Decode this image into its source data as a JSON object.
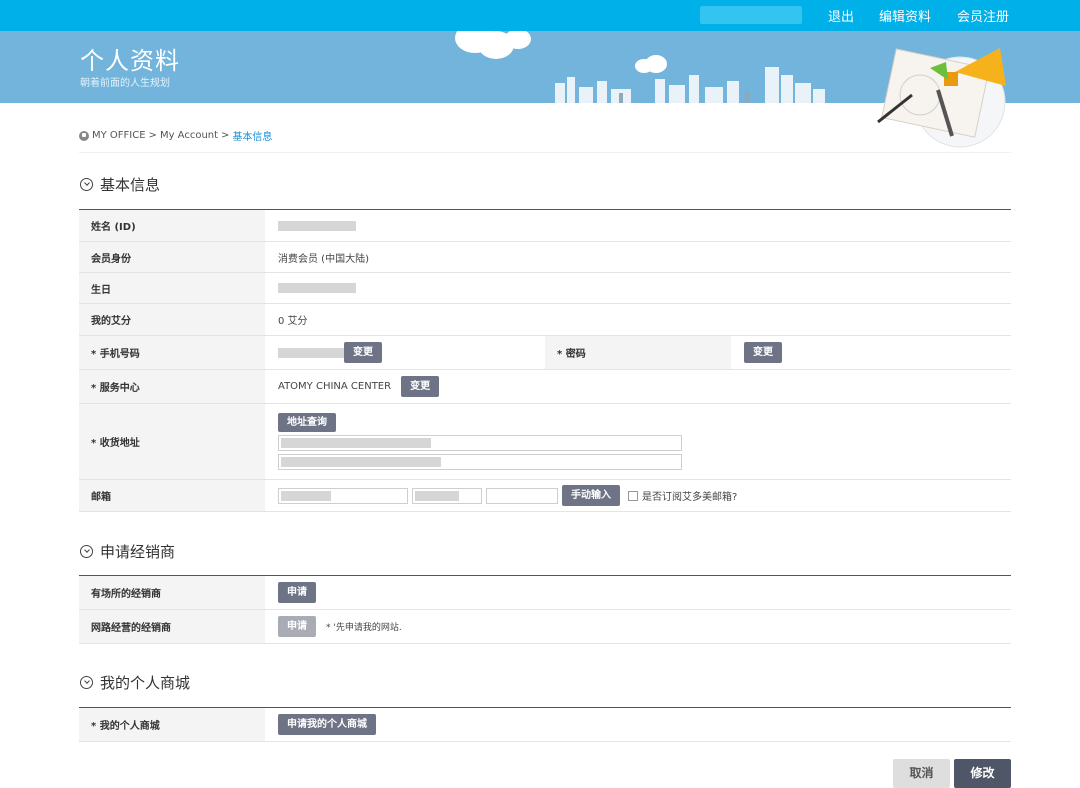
{
  "topbar": {
    "logout": "退出",
    "edit_profile": "编辑资料",
    "member_register": "会员注册"
  },
  "banner": {
    "title": "个人资料",
    "subtitle": "朝着前面的人生规划"
  },
  "breadcrumb": {
    "item1": "MY OFFICE",
    "sep": ">",
    "item2": "My Account",
    "current": "基本信息"
  },
  "sections": {
    "basic": "基本信息",
    "distributor": "申请经销商",
    "mall": "我的个人商城"
  },
  "basic": {
    "name_label": "姓名 (ID)",
    "membership_label": "会员身份",
    "membership_value": "消费会员 (中国大陆)",
    "birthday_label": "生日",
    "points_label": "我的艾分",
    "points_value": "0 艾分",
    "phone_label": "* 手机号码",
    "change": "变更",
    "password_label": "* 密码",
    "center_label": "* 服务中心",
    "center_value": "ATOMY CHINA CENTER",
    "address_label": "* 收货地址",
    "address_search": "地址查询",
    "email_label": "邮箱",
    "manual_input": "手动输入",
    "subscribe_label": "是否订阅艾多美邮箱?"
  },
  "distributor": {
    "store_label": "有场所的经销商",
    "online_label": "网路经营的经销商",
    "apply": "申请",
    "online_note": "* '先申请我的网站."
  },
  "mall": {
    "label": "* 我的个人商城",
    "apply_button": "申请我的个人商城"
  },
  "footer": {
    "cancel": "取消",
    "submit": "修改"
  },
  "colors": {
    "topbar": "#00b0e8",
    "banner": "#72b4dc",
    "button": "#6e7385",
    "link": "#1a8fd4"
  }
}
